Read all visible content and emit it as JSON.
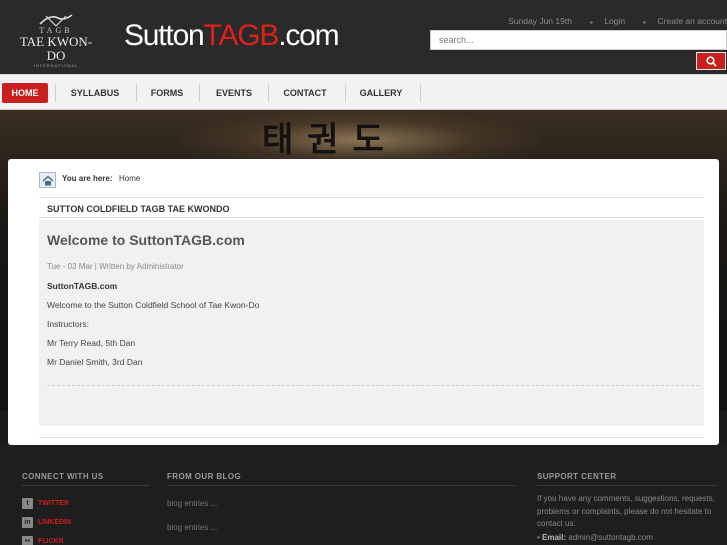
{
  "header": {
    "logo": {
      "line1": "TAGB",
      "line2": "TAE KWON-DO",
      "line3": "INTERNATIONAL"
    },
    "site_title_white": "Sutton",
    "site_title_red": "TAGB",
    "site_title_suffix": ".com",
    "date": "Sunday Jun 19th",
    "login": "Login",
    "create_account": "Create an account",
    "search_placeholder": "search...",
    "search_icon": "search-icon"
  },
  "nav": {
    "items": [
      {
        "label": "HOME",
        "active": true
      },
      {
        "label": "SYLLABUS",
        "active": false
      },
      {
        "label": "FORMS",
        "active": false
      },
      {
        "label": "EVENTS",
        "active": false
      },
      {
        "label": "CONTACT",
        "active": false
      },
      {
        "label": "GALLERY",
        "active": false
      }
    ]
  },
  "banner": {
    "text": "태권도"
  },
  "breadcrumb": {
    "label": "You are here:",
    "current": "Home",
    "icon": "home-icon"
  },
  "section_title": "SUTTON COLDFIELD TAGB TAE KWONDO",
  "article": {
    "title": "Welcome to SuttonTAGB.com",
    "meta": "Tue - 03 Mar  | Written by Administrator",
    "paragraphs": [
      "SuttonTAGB.com",
      "Welcome to the Sutton Coldfield School of Tae Kwon-Do",
      "Instructors:",
      "Mr Terry Read, 5th Dan",
      "Mr Daniel Smith, 3rd Dan"
    ]
  },
  "footer": {
    "connect": {
      "heading": "CONNECT WITH US",
      "items": [
        {
          "label": "TWITTER",
          "icon": "twitter-icon"
        },
        {
          "label": "LINKEDIN",
          "icon": "linkedin-icon"
        },
        {
          "label": "FLICKR",
          "icon": "flickr-icon"
        }
      ]
    },
    "blog": {
      "heading": "FROM OUR BLOG",
      "entries": [
        "blog entries ...",
        "blog entries ..."
      ]
    },
    "support": {
      "heading": "SUPPORT CENTER",
      "text": "If you have any comments, suggestions, requests, problems or complaints, please do not hesitate to contact us:",
      "email_label": "Email:",
      "email": "admin@suttontagb.com"
    }
  },
  "colors": {
    "accent": "#c8201e",
    "header_bg": "#2a2a2a",
    "footer_bg": "#1e1e1e"
  }
}
